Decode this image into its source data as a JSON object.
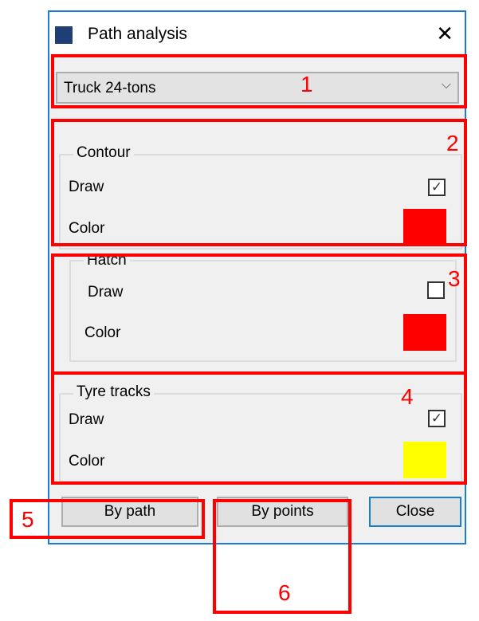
{
  "window": {
    "title": "Path analysis",
    "app_icon": "path-analysis-icon",
    "close_icon": "close-icon"
  },
  "vehicle_select": {
    "value": "Truck 24-tons",
    "arrow_icon": "chevron-down-icon"
  },
  "groups": [
    {
      "legend": "Contour",
      "draw_label": "Draw",
      "draw_checked": true,
      "color_label": "Color",
      "color": "#ff0000"
    },
    {
      "legend": "Hatch",
      "draw_label": "Draw",
      "draw_checked": false,
      "color_label": "Color",
      "color": "#ff0000"
    },
    {
      "legend": "Tyre tracks",
      "draw_label": "Draw",
      "draw_checked": true,
      "color_label": "Color",
      "color": "#ffff00"
    }
  ],
  "buttons": {
    "by_path": "By path",
    "by_points": "By points",
    "close": "Close"
  },
  "annotations": [
    "1",
    "2",
    "3",
    "4",
    "5",
    "6"
  ],
  "check_glyph": "✓"
}
